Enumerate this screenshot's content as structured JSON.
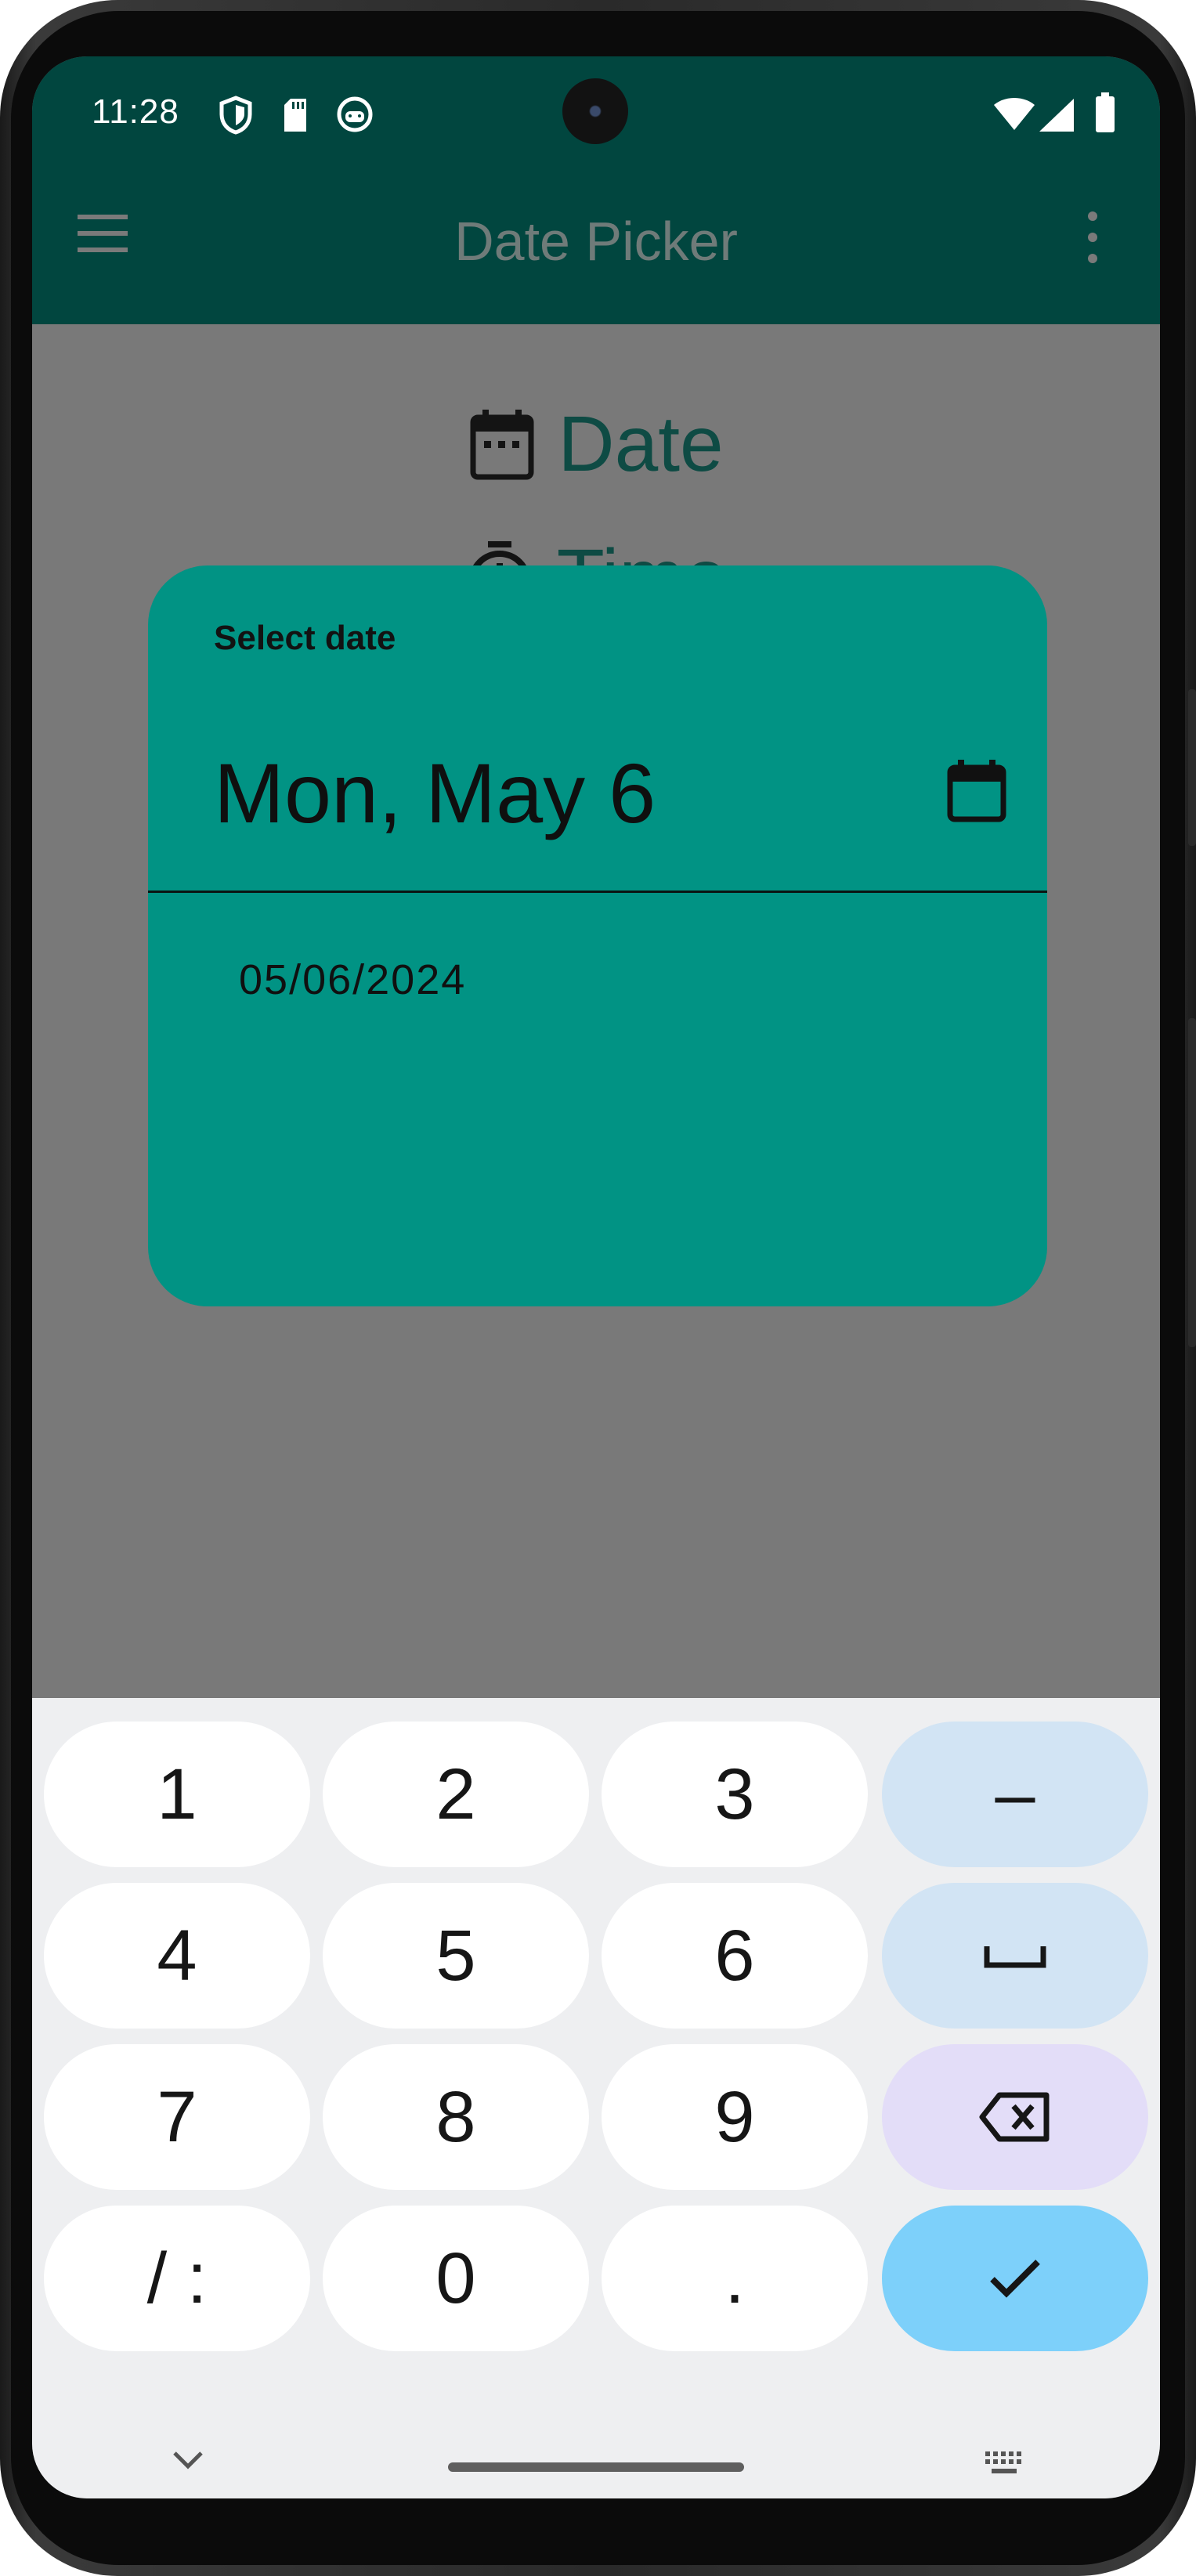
{
  "status_bar": {
    "time": "11:28",
    "left_icons": [
      "shield-icon",
      "sd-card-icon",
      "android-debug-icon"
    ],
    "right_icons": [
      "wifi-icon",
      "cell-signal-icon",
      "battery-icon"
    ]
  },
  "app_bar": {
    "title": "Date Picker",
    "nav_icon": "menu-icon",
    "action_icon": "more-vert-icon"
  },
  "content": {
    "date_label": "Date",
    "time_label": "Time"
  },
  "dialog": {
    "title": "Select date",
    "headline": "Mon, May 6",
    "mode_toggle_icon": "calendar-icon",
    "input_value": "05/06/2024"
  },
  "keyboard": {
    "keys": [
      [
        "1",
        "2",
        "3",
        "–"
      ],
      [
        "4",
        "5",
        "6",
        "␣"
      ],
      [
        "7",
        "8",
        "9",
        "⌫"
      ],
      [
        "/ :",
        "0",
        ".",
        "✓"
      ]
    ],
    "hide_icon": "chevron-down-icon",
    "switch_icon": "keyboard-icon"
  },
  "colors": {
    "app_bar": "#01463f",
    "dialog_surface": "#019384",
    "scrim": "#797979",
    "keyboard_bg": "#eeeff1",
    "enter_key": "#7dd0fa"
  }
}
